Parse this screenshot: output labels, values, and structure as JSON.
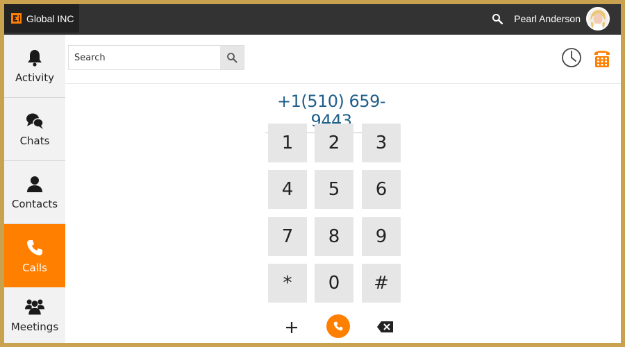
{
  "header": {
    "brand_name": "Global INC",
    "user_name": "Pearl Anderson"
  },
  "sidebar": {
    "items": [
      {
        "label": "Activity",
        "icon": "bell-icon",
        "active": false
      },
      {
        "label": "Chats",
        "icon": "chat-bubbles-icon",
        "active": false
      },
      {
        "label": "Contacts",
        "icon": "person-icon",
        "active": false
      },
      {
        "label": "Calls",
        "icon": "phone-icon",
        "active": true
      },
      {
        "label": "Meetings",
        "icon": "group-icon",
        "active": false
      }
    ]
  },
  "search": {
    "placeholder": "Search",
    "value": ""
  },
  "dialer": {
    "number": "+1(510) 659-9443",
    "keys": [
      "1",
      "2",
      "3",
      "4",
      "5",
      "6",
      "7",
      "8",
      "9",
      "*",
      "0",
      "#"
    ]
  },
  "colors": {
    "accent": "#ff7f00",
    "frame": "#c9a24f",
    "topbar": "#333333",
    "number": "#1f5f8b"
  }
}
